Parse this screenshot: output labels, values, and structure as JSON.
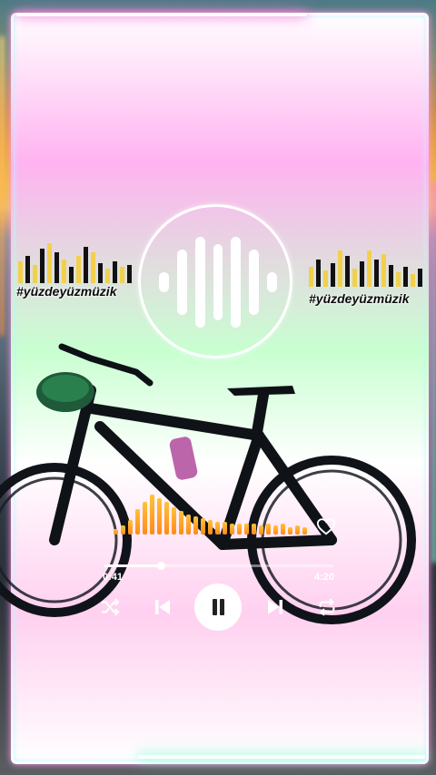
{
  "brand": {
    "tag_left": "#yüzdeyüzmüzik",
    "tag_right": "#yüzdeyüzmüzik"
  },
  "player": {
    "current_time": "0:41",
    "total_time": "4:20",
    "progress": 0.247,
    "liked": false
  },
  "icons": {
    "shuffle": "shuffle-icon",
    "previous": "skip-previous-icon",
    "pause": "pause-icon",
    "next": "skip-next-icon",
    "repeat": "repeat-icon",
    "like": "heart-icon"
  },
  "colors": {
    "eq_yellow": "#f2d04a",
    "eq_dark": "#111111",
    "accent_orange": "#ff9a1f",
    "frame_pink": "#ff9cf0",
    "frame_mint": "#9cffd8"
  }
}
